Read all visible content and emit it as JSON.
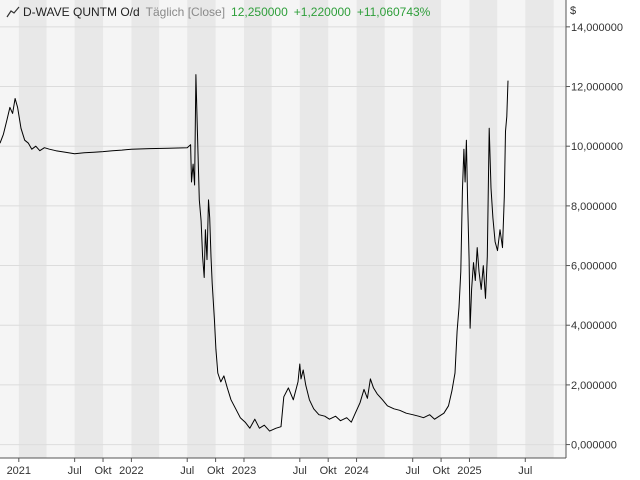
{
  "header": {
    "symbol": "D-WAVE QUNTM O/d",
    "period": "Täglich [Close]",
    "last": "12,250000",
    "change": "+1,220000",
    "change_pct": "+11,060743%",
    "currency": "$"
  },
  "colors": {
    "line": "#000000",
    "positive": "#2e9e3a",
    "band_dark": "#e8e8e8",
    "band_light": "#f5f5f5"
  },
  "chart_data": {
    "type": "line",
    "x_axis": {
      "range": [
        "2020-11-01",
        "2025-11-10"
      ],
      "ticks": [
        {
          "label": "2021",
          "date": "2021-01-01"
        },
        {
          "label": "Jul",
          "date": "2021-07-01"
        },
        {
          "label": "Okt",
          "date": "2021-10-01"
        },
        {
          "label": "2022",
          "date": "2022-01-01"
        },
        {
          "label": "Jul",
          "date": "2022-07-01"
        },
        {
          "label": "Okt",
          "date": "2022-10-01"
        },
        {
          "label": "2023",
          "date": "2023-01-01"
        },
        {
          "label": "Jul",
          "date": "2023-07-01"
        },
        {
          "label": "Okt",
          "date": "2023-10-01"
        },
        {
          "label": "2024",
          "date": "2024-01-01"
        },
        {
          "label": "Jul",
          "date": "2024-07-01"
        },
        {
          "label": "Okt",
          "date": "2024-10-01"
        },
        {
          "label": "2025",
          "date": "2025-01-01"
        },
        {
          "label": "Jul",
          "date": "2025-07-01"
        }
      ],
      "bands": [
        "2021-01-01",
        "2021-04-01",
        "2021-07-01",
        "2021-10-01",
        "2022-01-01",
        "2022-04-01",
        "2022-07-01",
        "2022-10-01",
        "2023-01-01",
        "2023-04-01",
        "2023-07-01",
        "2023-10-01",
        "2024-01-01",
        "2024-04-01",
        "2024-07-01",
        "2024-10-01",
        "2025-01-01",
        "2025-04-01",
        "2025-07-01",
        "2025-10-01"
      ]
    },
    "y_axis": {
      "range": [
        -0.45,
        14.9
      ],
      "ticks": [
        {
          "label": "0,000000",
          "value": 0
        },
        {
          "label": "2,000000",
          "value": 2
        },
        {
          "label": "4,000000",
          "value": 4
        },
        {
          "label": "6,000000",
          "value": 6
        },
        {
          "label": "8,000000",
          "value": 8
        },
        {
          "label": "10,000000",
          "value": 10
        },
        {
          "label": "12,000000",
          "value": 12
        },
        {
          "label": "14,000000",
          "value": 14
        }
      ]
    },
    "grid": true,
    "series": [
      {
        "points": [
          [
            "2020-11-01",
            10.1
          ],
          [
            "2020-11-12",
            10.4
          ],
          [
            "2020-11-24",
            10.9
          ],
          [
            "2020-12-03",
            11.3
          ],
          [
            "2020-12-12",
            11.1
          ],
          [
            "2020-12-20",
            11.6
          ],
          [
            "2020-12-28",
            11.3
          ],
          [
            "2021-01-08",
            10.6
          ],
          [
            "2021-01-20",
            10.2
          ],
          [
            "2021-02-01",
            10.1
          ],
          [
            "2021-02-12",
            9.9
          ],
          [
            "2021-02-25",
            10.0
          ],
          [
            "2021-03-10",
            9.85
          ],
          [
            "2021-03-25",
            9.95
          ],
          [
            "2021-04-10",
            9.9
          ],
          [
            "2021-05-01",
            9.85
          ],
          [
            "2021-06-01",
            9.8
          ],
          [
            "2021-07-01",
            9.75
          ],
          [
            "2021-08-01",
            9.78
          ],
          [
            "2021-09-01",
            9.8
          ],
          [
            "2021-10-01",
            9.82
          ],
          [
            "2021-11-01",
            9.85
          ],
          [
            "2021-12-01",
            9.87
          ],
          [
            "2022-01-01",
            9.9
          ],
          [
            "2022-03-01",
            9.92
          ],
          [
            "2022-05-01",
            9.93
          ],
          [
            "2022-07-01",
            9.95
          ],
          [
            "2022-07-12",
            10.05
          ],
          [
            "2022-07-15",
            8.8
          ],
          [
            "2022-07-20",
            9.4
          ],
          [
            "2022-07-25",
            8.7
          ],
          [
            "2022-07-29",
            12.4
          ],
          [
            "2022-08-03",
            10.5
          ],
          [
            "2022-08-09",
            8.2
          ],
          [
            "2022-08-15",
            7.5
          ],
          [
            "2022-08-20",
            6.3
          ],
          [
            "2022-08-25",
            5.6
          ],
          [
            "2022-08-29",
            7.2
          ],
          [
            "2022-09-03",
            6.2
          ],
          [
            "2022-09-08",
            8.2
          ],
          [
            "2022-09-12",
            7.6
          ],
          [
            "2022-09-16",
            6.3
          ],
          [
            "2022-09-20",
            5.4
          ],
          [
            "2022-09-27",
            4.2
          ],
          [
            "2022-10-02",
            3.2
          ],
          [
            "2022-10-08",
            2.4
          ],
          [
            "2022-10-18",
            2.1
          ],
          [
            "2022-10-28",
            2.3
          ],
          [
            "2022-11-08",
            1.9
          ],
          [
            "2022-11-20",
            1.5
          ],
          [
            "2022-12-05",
            1.2
          ],
          [
            "2022-12-20",
            0.9
          ],
          [
            "2023-01-05",
            0.75
          ],
          [
            "2023-01-20",
            0.55
          ],
          [
            "2023-02-05",
            0.85
          ],
          [
            "2023-02-20",
            0.55
          ],
          [
            "2023-03-08",
            0.65
          ],
          [
            "2023-03-25",
            0.45
          ],
          [
            "2023-04-15",
            0.55
          ],
          [
            "2023-05-01",
            0.6
          ],
          [
            "2023-05-10",
            1.6
          ],
          [
            "2023-05-25",
            1.9
          ],
          [
            "2023-06-10",
            1.5
          ],
          [
            "2023-06-25",
            2.1
          ],
          [
            "2023-07-01",
            2.7
          ],
          [
            "2023-07-05",
            2.2
          ],
          [
            "2023-07-12",
            2.5
          ],
          [
            "2023-07-20",
            2.0
          ],
          [
            "2023-08-01",
            1.5
          ],
          [
            "2023-08-15",
            1.2
          ],
          [
            "2023-09-01",
            1.0
          ],
          [
            "2023-09-20",
            0.95
          ],
          [
            "2023-10-05",
            0.85
          ],
          [
            "2023-10-25",
            0.95
          ],
          [
            "2023-11-10",
            0.8
          ],
          [
            "2023-11-30",
            0.9
          ],
          [
            "2023-12-15",
            0.75
          ],
          [
            "2023-12-28",
            1.05
          ],
          [
            "2024-01-12",
            1.4
          ],
          [
            "2024-01-25",
            1.85
          ],
          [
            "2024-02-05",
            1.55
          ],
          [
            "2024-02-15",
            2.2
          ],
          [
            "2024-02-25",
            1.9
          ],
          [
            "2024-03-08",
            1.7
          ],
          [
            "2024-03-25",
            1.5
          ],
          [
            "2024-04-10",
            1.3
          ],
          [
            "2024-05-01",
            1.2
          ],
          [
            "2024-05-20",
            1.15
          ],
          [
            "2024-06-10",
            1.05
          ],
          [
            "2024-07-01",
            1.0
          ],
          [
            "2024-07-20",
            0.95
          ],
          [
            "2024-08-05",
            0.9
          ],
          [
            "2024-08-25",
            1.0
          ],
          [
            "2024-09-10",
            0.85
          ],
          [
            "2024-09-25",
            0.95
          ],
          [
            "2024-10-10",
            1.05
          ],
          [
            "2024-10-25",
            1.3
          ],
          [
            "2024-11-05",
            1.8
          ],
          [
            "2024-11-15",
            2.4
          ],
          [
            "2024-11-22",
            3.8
          ],
          [
            "2024-11-28",
            4.6
          ],
          [
            "2024-12-04",
            5.8
          ],
          [
            "2024-12-09",
            8.5
          ],
          [
            "2024-12-14",
            9.9
          ],
          [
            "2024-12-18",
            8.8
          ],
          [
            "2024-12-22",
            10.2
          ],
          [
            "2024-12-26",
            8.2
          ],
          [
            "2024-12-31",
            6.2
          ],
          [
            "2025-01-03",
            3.9
          ],
          [
            "2025-01-08",
            5.2
          ],
          [
            "2025-01-14",
            6.1
          ],
          [
            "2025-01-20",
            5.5
          ],
          [
            "2025-01-26",
            6.6
          ],
          [
            "2025-02-01",
            5.8
          ],
          [
            "2025-02-08",
            5.2
          ],
          [
            "2025-02-15",
            6.0
          ],
          [
            "2025-02-22",
            4.9
          ],
          [
            "2025-02-28",
            6.3
          ],
          [
            "2025-03-06",
            10.6
          ],
          [
            "2025-03-12",
            8.6
          ],
          [
            "2025-03-18",
            7.6
          ],
          [
            "2025-03-25",
            6.8
          ],
          [
            "2025-04-02",
            6.5
          ],
          [
            "2025-04-10",
            7.2
          ],
          [
            "2025-04-18",
            6.6
          ],
          [
            "2025-04-24",
            8.3
          ],
          [
            "2025-04-28",
            10.5
          ],
          [
            "2025-05-02",
            11.0
          ],
          [
            "2025-05-06",
            12.2
          ]
        ]
      }
    ]
  }
}
